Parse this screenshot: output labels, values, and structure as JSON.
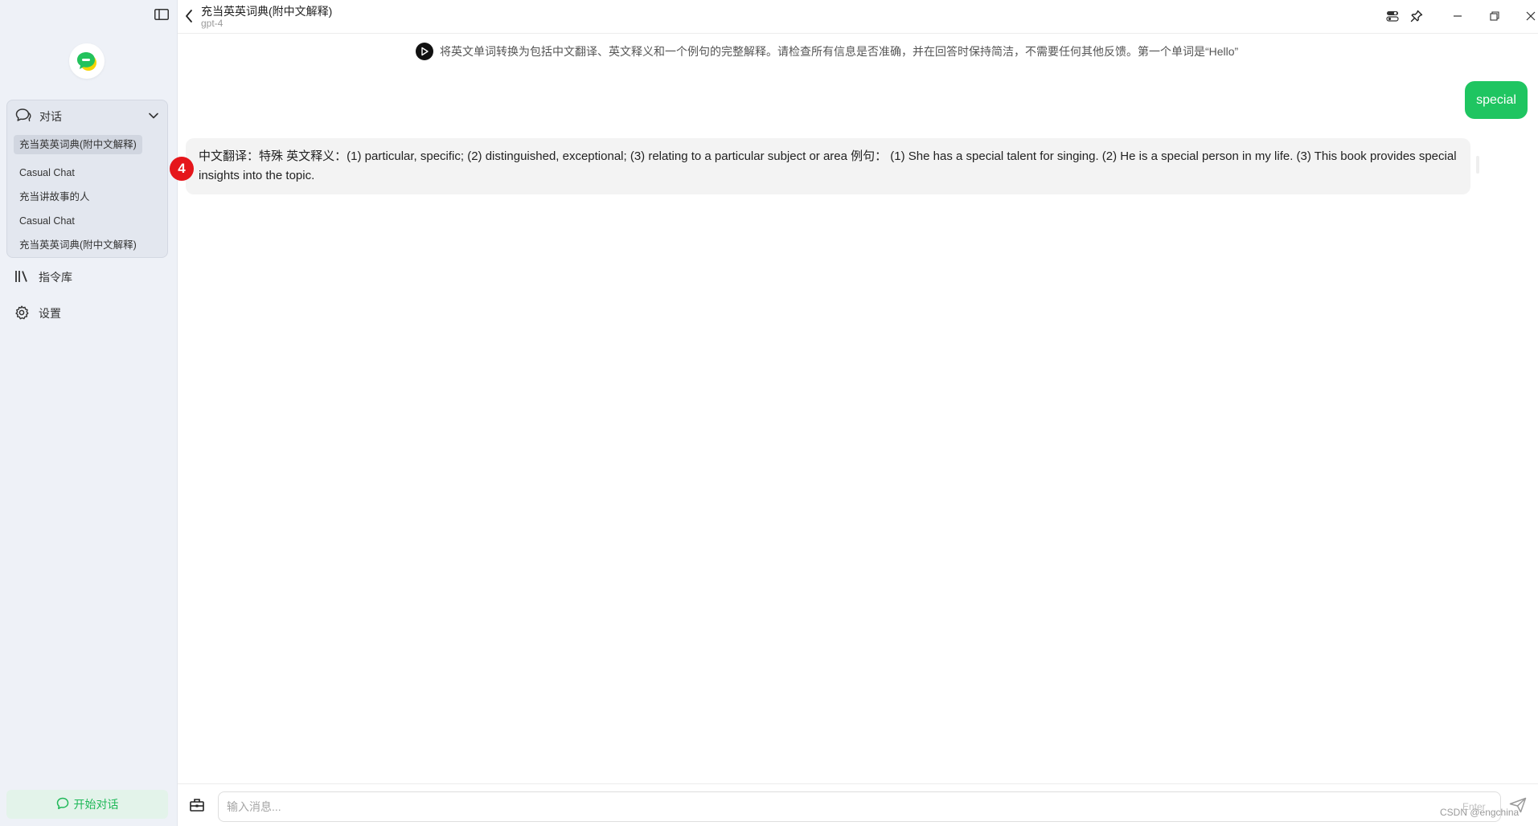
{
  "sidebar": {
    "toggle_icon": "sidebar-toggle-icon",
    "logo_icon": "chat-logo-icon",
    "conversations": {
      "label": "对话",
      "items": [
        {
          "label": "充当英英词典(附中文解释)",
          "active": true
        },
        {
          "label": "Casual Chat",
          "active": false
        },
        {
          "label": "充当讲故事的人",
          "active": false
        },
        {
          "label": "Casual Chat",
          "active": false
        },
        {
          "label": "充当英英词典(附中文解释)",
          "active": false
        }
      ]
    },
    "prompt_library_label": "指令库",
    "settings_label": "设置",
    "new_chat_label": "开始对话"
  },
  "header": {
    "title": "充当英英词典(附中文解释)",
    "model": "gpt-4"
  },
  "chat": {
    "system_prompt": "将英文单词转换为包括中文翻译、英文释义和一个例句的完整解释。请检查所有信息是否准确，并在回答时保持简洁，不需要任何其他反馈。第一个单词是“Hello”",
    "user_message": "special",
    "assistant_reply": "中文翻译：特殊 英文释义：(1) particular, specific; (2) distinguished, exceptional; (3) relating to a particular subject or area 例句： (1) She has a special talent for singing. (2) He is a special person in my life. (3) This book provides special insights into the topic.",
    "annotation_badge": "4"
  },
  "input": {
    "placeholder": "输入消息...",
    "enter_hint": "Enter"
  },
  "watermark": "CSDN @engchina",
  "colors": {
    "accent": "#1fc561",
    "sidebar_bg": "#eef1f7",
    "badge": "#e5161b"
  }
}
